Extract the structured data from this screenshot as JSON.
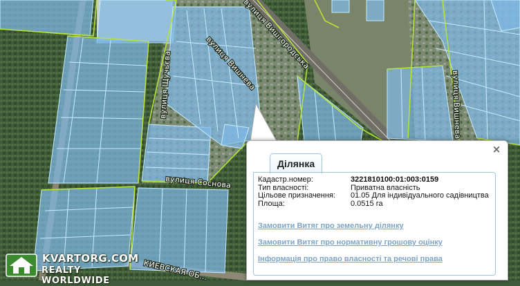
{
  "map": {
    "streets": {
      "vyshgorodska": "вулиця Вишгородська",
      "vyshneva": "вулиця Вишнева",
      "shchuchyeva": "вулиця Щучьєва",
      "sosnova": "вулиця Соснова",
      "shevchenka_right": "вулиця Вишнева",
      "kyivska": "КИЕВСКАЯ ОБ..."
    }
  },
  "popup": {
    "tab_label": "Ділянка",
    "close_symbol": "×",
    "rows": [
      {
        "label": "Кадастр.номер:",
        "value": "3221810100:01:003:0159"
      },
      {
        "label": "Тип власності:",
        "value": "Приватна власність"
      },
      {
        "label": "Цільове призначення:",
        "value": "01.05 Для індивідуального садівництва"
      },
      {
        "label": "Площа:",
        "value": "0.0515 га"
      }
    ],
    "links": [
      "Замовити Витяг про земельну ділянку",
      "Замовити Витяг про нормативну грошову оцінку",
      "Інформація про право власності та речові права"
    ]
  },
  "watermark": {
    "line1": "KVARTORG.COM",
    "line2": "REALTY WORLDWIDE"
  }
}
